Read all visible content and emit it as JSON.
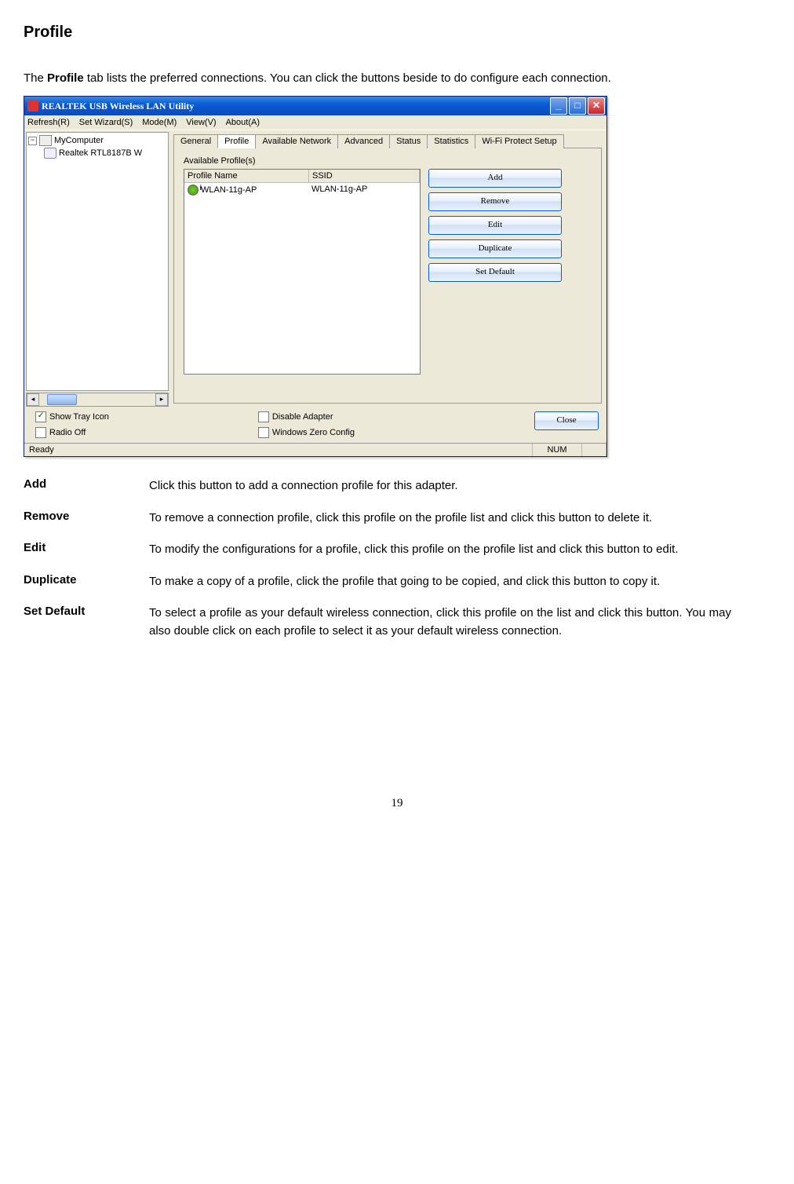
{
  "doc": {
    "heading": "Profile",
    "intro_prefix": "The ",
    "intro_bold": "Profile",
    "intro_suffix": " tab lists the preferred connections. You can click the buttons beside to do configure each connection.",
    "page_number": "19"
  },
  "app": {
    "title": "REALTEK USB Wireless LAN Utility",
    "menus": {
      "refresh": "Refresh(R)",
      "setwizard": "Set Wizard(S)",
      "mode": "Mode(M)",
      "view": "View(V)",
      "about": "About(A)"
    },
    "tree": {
      "root": "MyComputer",
      "child": "Realtek RTL8187B W"
    },
    "tabs": {
      "general": "General",
      "profile": "Profile",
      "available_network": "Available Network",
      "advanced": "Advanced",
      "status": "Status",
      "statistics": "Statistics",
      "wps": "Wi-Fi Protect Setup"
    },
    "group_label": "Available Profile(s)",
    "list_headers": {
      "col1": "Profile Name",
      "col2": "SSID"
    },
    "list_rows": [
      {
        "name": "WLAN-11g-AP",
        "ssid": "WLAN-11g-AP"
      }
    ],
    "buttons": {
      "add": "Add",
      "remove": "Remove",
      "edit": "Edit",
      "duplicate": "Duplicate",
      "set_default": "Set Default",
      "close": "Close"
    },
    "checks": {
      "show_tray": "Show Tray Icon",
      "radio_off": "Radio Off",
      "disable_adapter": "Disable Adapter",
      "win_zero": "Windows Zero Config"
    },
    "status": {
      "ready": "Ready",
      "num": "NUM"
    }
  },
  "defs": {
    "add": {
      "term": "Add",
      "desc": "Click this button to add a connection profile for this adapter."
    },
    "remove": {
      "term": "Remove",
      "desc": "To remove a connection profile, click this profile on the profile list and click this button to delete it."
    },
    "edit": {
      "term": "Edit",
      "desc": "To modify the configurations for a profile, click this profile on the profile list and click this button to edit."
    },
    "duplicate": {
      "term": "Duplicate",
      "desc": "To make a copy of a profile, click the profile that going to be copied, and click this button to copy it."
    },
    "set_default": {
      "term": "Set Default",
      "desc": "To select a profile as your default wireless connection, click this profile on the list and click this button. You may also double click on each profile to select it as your default wireless connection."
    }
  }
}
